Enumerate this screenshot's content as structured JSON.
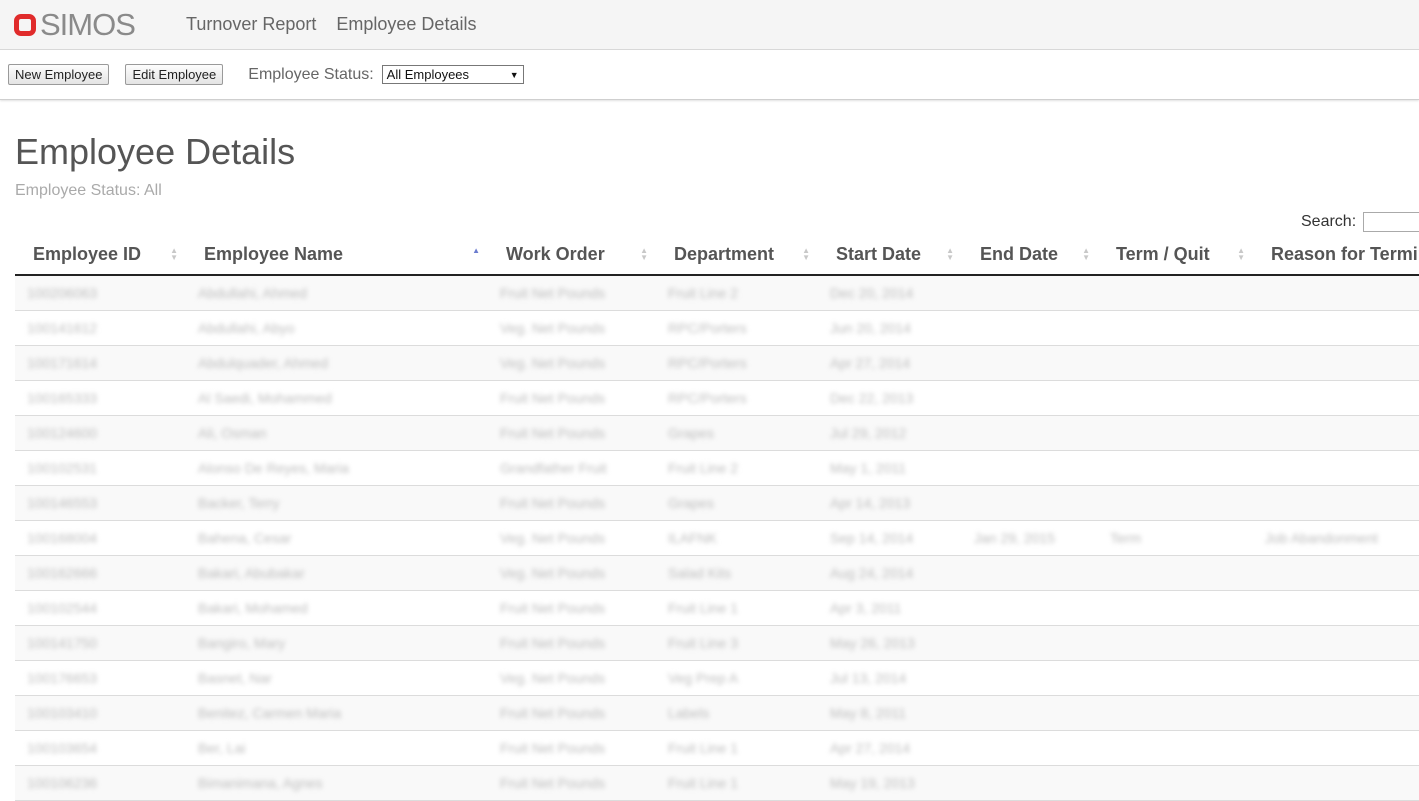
{
  "brand": {
    "name": "SIMOS"
  },
  "nav": {
    "links": [
      "Turnover Report",
      "Employee Details"
    ]
  },
  "toolbar": {
    "new_label": "New Employee",
    "edit_label": "Edit Employee",
    "status_label": "Employee Status:",
    "status_selected": "All Employees"
  },
  "page": {
    "title": "Employee Details",
    "subtitle": "Employee Status: All"
  },
  "search": {
    "label": "Search:"
  },
  "table": {
    "columns": [
      "Employee ID",
      "Employee Name",
      "Work Order",
      "Department",
      "Start Date",
      "End Date",
      "Term / Quit",
      "Reason for Termination"
    ],
    "rows": [
      [
        "100206063",
        "Abdullahi, Ahmed",
        "Fruit Net Pounds",
        "Fruit Line 2",
        "Dec 20, 2014",
        "",
        "",
        ""
      ],
      [
        "100141612",
        "Abdullahi, Abyo",
        "Veg. Net Pounds",
        "RPC/Porters",
        "Jun 20, 2014",
        "",
        "",
        ""
      ],
      [
        "100171614",
        "Abdulquader, Ahmed",
        "Veg. Net Pounds",
        "RPC/Porters",
        "Apr 27, 2014",
        "",
        "",
        ""
      ],
      [
        "100165333",
        "Al Saedi, Mohammed",
        "Fruit Net Pounds",
        "RPC/Porters",
        "Dec 22, 2013",
        "",
        "",
        ""
      ],
      [
        "100124600",
        "Ali, Osman",
        "Fruit Net Pounds",
        "Grapes",
        "Jul 29, 2012",
        "",
        "",
        ""
      ],
      [
        "100102531",
        "Alonso De Reyes, Maria",
        "Grandfather Fruit",
        "Fruit Line 2",
        "May 1, 2011",
        "",
        "",
        ""
      ],
      [
        "100146553",
        "Backer, Terry",
        "Fruit Net Pounds",
        "Grapes",
        "Apr 14, 2013",
        "",
        "",
        ""
      ],
      [
        "100168004",
        "Bahena, Cesar",
        "Veg. Net Pounds",
        "ILAFNK",
        "Sep 14, 2014",
        "Jan 29, 2015",
        "Term",
        "Job Abandonment"
      ],
      [
        "100162666",
        "Bakari, Abubakar",
        "Veg. Net Pounds",
        "Salad Kits",
        "Aug 24, 2014",
        "",
        "",
        ""
      ],
      [
        "100102544",
        "Bakari, Mohamed",
        "Fruit Net Pounds",
        "Fruit Line 1",
        "Apr 3, 2011",
        "",
        "",
        ""
      ],
      [
        "100141750",
        "Bangiro, Mary",
        "Fruit Net Pounds",
        "Fruit Line 3",
        "May 26, 2013",
        "",
        "",
        ""
      ],
      [
        "100176653",
        "Basnet, Nar",
        "Veg. Net Pounds",
        "Veg Prep A",
        "Jul 13, 2014",
        "",
        "",
        ""
      ],
      [
        "100103410",
        "Benitez, Carmen Maria",
        "Fruit Net Pounds",
        "Labels",
        "May 8, 2011",
        "",
        "",
        ""
      ],
      [
        "100103654",
        "Ber, Lai",
        "Fruit Net Pounds",
        "Fruit Line 1",
        "Apr 27, 2014",
        "",
        "",
        ""
      ],
      [
        "100106236",
        "Bimanimana, Agnes",
        "Fruit Net Pounds",
        "Fruit Line 1",
        "May 19, 2013",
        "",
        "",
        ""
      ]
    ]
  },
  "colors": {
    "brand_red": "#e02b2b",
    "sort_active": "#6b7ccf"
  }
}
